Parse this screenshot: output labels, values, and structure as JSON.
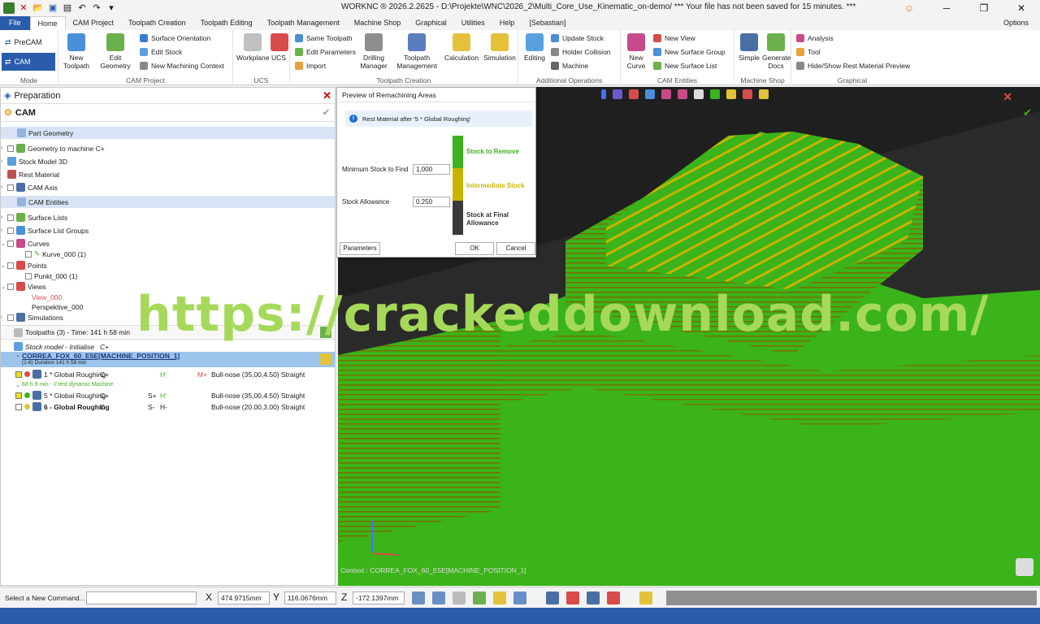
{
  "titlebar": {
    "title": "WORKNC ® 2026.2.2625 - D:\\Projekte\\WNC\\2026_2\\Multi_Core_Use_Kinematic_on-demo/ *** Your file has not been saved for 15 minutes. ***",
    "options": "Options"
  },
  "menu": {
    "file": "File",
    "tabs": [
      "Home",
      "CAM Project",
      "Toolpath Creation",
      "Toolpath Editing",
      "Toolpath Management",
      "Machine Shop",
      "Graphical",
      "Utilities",
      "Help",
      "[Sebastian]"
    ]
  },
  "ribbon": {
    "mode": {
      "precam": "PreCAM",
      "cam": "CAM",
      "label": "Mode"
    },
    "new_toolpath": "New\nToolpath",
    "edit_geometry": "Edit\nGeometry",
    "surface_orientation": "Surface Orientation",
    "edit_stock": "Edit Stock",
    "new_machining_context": "New Machining Context",
    "cam_project": "CAM Project",
    "workplane": "Workplane",
    "ucs": "UCS",
    "ucs_label": "UCS",
    "same_toolpath": "Same Toolpath",
    "edit_parameters": "Edit Parameters",
    "import": "Import",
    "drilling_manager": "Drilling\nManager",
    "toolpath_management": "Toolpath\nManagement",
    "calculation": "Calculation",
    "simulation": "Simulation",
    "toolpath_creation": "Toolpath Creation",
    "editing": "Editing",
    "update_stock": "Update Stock",
    "holder_collision": "Holder Collision",
    "machine": "Machine",
    "additional_operations": "Additional Operations",
    "new_curve": "New\nCurve",
    "new_view": "New View",
    "new_surface_group": "New Surface Group",
    "new_surface_list": "New Surface List",
    "cam_entities": "CAM Entities",
    "simple": "Simple",
    "generate_docs": "Generate\nDocs",
    "machine_shop": "Machine Shop",
    "analysis": "Analysis",
    "tool": "Tool",
    "hide_show_rest": "Hide/Show Rest Material Preview",
    "graphical": "Graphical"
  },
  "left": {
    "header": "Preparation",
    "cam": "CAM",
    "rows": [
      "Part Geometry",
      "Geometry to machine C+",
      "Stock Model 3D",
      "Rest Material",
      "CAM Axis",
      "CAM Entities",
      "Surface Lists",
      "Surface List Groups",
      "Curves",
      "Kurve_000 (1)",
      "Points",
      "Punkt_000 (1)",
      "Views",
      "View_000",
      "Perspektive_000",
      "Simulations"
    ],
    "toolpaths": "Toolpaths (3) - Time: 141 h 58 min",
    "stock_init": "Stock model - Initialise",
    "stock_init_c": "C+",
    "machine_pos": "CORREA_FOX_60_E5E[MACHINE_POSITION_1]",
    "duration": "(1-6) Duration 141 h 58 min",
    "tp1": "1 * Global Roughing",
    "tp1_c": "C+",
    "tp1_h": "H'",
    "tp1_m": "M+",
    "tp1_tool": "Bull-nose (35,00,4.50) Straight",
    "dyn": "68 h 9 min - // test dynamic Machine",
    "tp5": "5 * Global Roughing",
    "tp5_c": "C+",
    "tp5_s": "S+",
    "tp5_h": "H'",
    "tp5_tool": "Bull-nose (35,00,4.50) Straight",
    "tp6": "6 - Global Roughing",
    "tp6_c": "C-",
    "tp6_s": "S-",
    "tp6_h": "H-",
    "tp6_tool": "Bull-nose (20.00,3.00) Straight"
  },
  "dialog": {
    "title": "Preview of Remachining Areas",
    "info": "Rest Material after '5 * Global Roughing'",
    "min_stock_label": "Minimum Stock to Find",
    "min_stock": "1,000",
    "allowance_label": "Stock Allowance",
    "allowance": "0.250",
    "legend": [
      "Stock to Remove",
      "Intermediate Stock",
      "Stock at Final Allowance"
    ],
    "parameters": "Parameters",
    "ok": "OK",
    "cancel": "Cancel"
  },
  "watermark": "https://crackeddownload.com/",
  "context": "Context : CORREA_FOX_60_E5E[MACHINE_POSITION_1]",
  "status": {
    "cmd": "Select a New Command...",
    "x_label": "X",
    "x": "474.9715mm",
    "y_label": "Y",
    "y": "116.0676mm",
    "z_label": "Z",
    "z": "-172.1397mm"
  },
  "colors": {
    "accent": "#2a5cab",
    "stock_green": "#3bb31a",
    "intermediate": "#c8b400"
  }
}
